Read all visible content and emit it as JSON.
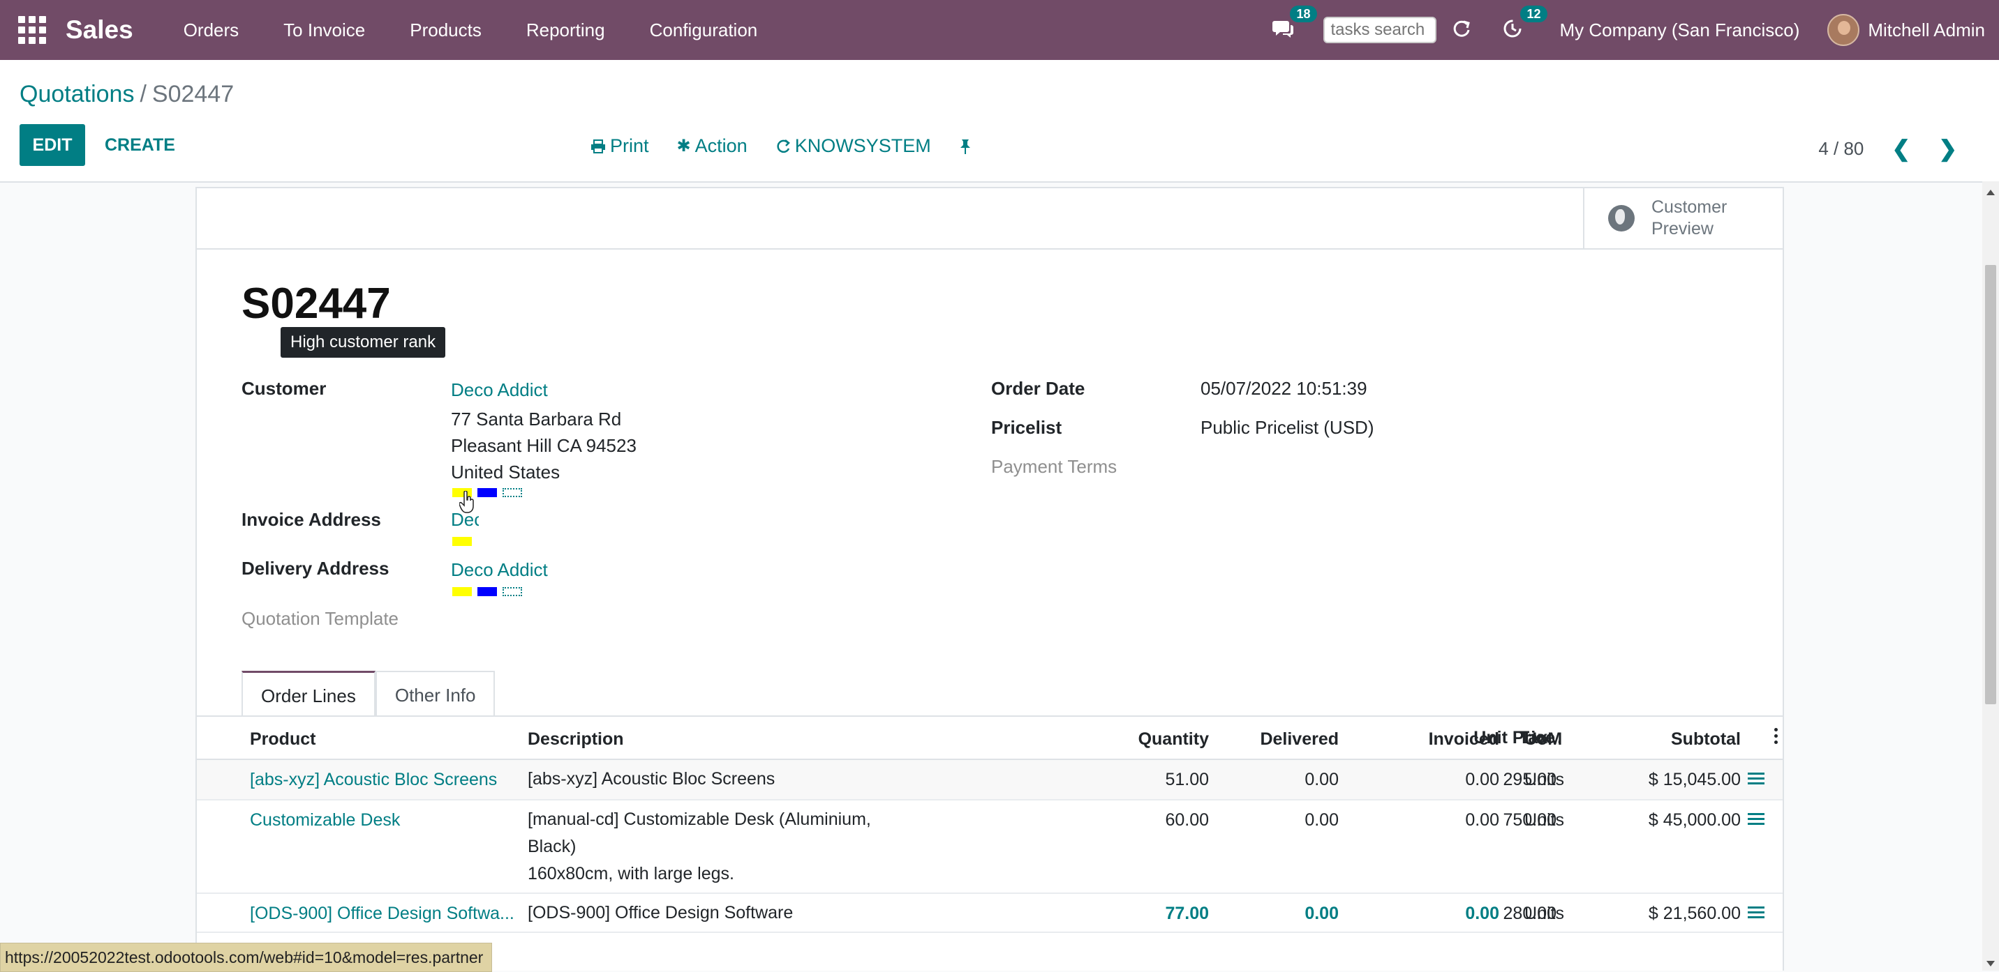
{
  "navbar": {
    "brand": "Sales",
    "menu": [
      "Orders",
      "To Invoice",
      "Products",
      "Reporting",
      "Configuration"
    ],
    "messages_count": "18",
    "tasks_search_placeholder": "tasks search",
    "activities_count": "12",
    "company": "My Company (San Francisco)",
    "user": "Mitchell Admin"
  },
  "breadcrumb": {
    "parent": "Quotations",
    "separator": "/",
    "current": "S02447"
  },
  "buttons": {
    "edit": "EDIT",
    "create": "CREATE"
  },
  "actions": {
    "print": "Print",
    "action": "Action",
    "knowsystem": "KNOWSYSTEM"
  },
  "pager": {
    "value": "4 / 80"
  },
  "sheet": {
    "customer_preview": "Customer Preview",
    "title": "S02447",
    "customer_label": "Customer",
    "customer_name": "Deco Addict",
    "address": [
      "77 Santa Barbara Rd",
      "Pleasant Hill CA 94523",
      "United States"
    ],
    "invoice_address_label": "Invoice Address",
    "invoice_address_value": "Deco Addict",
    "delivery_address_label": "Delivery Address",
    "delivery_address_value": "Deco Addict",
    "quotation_template_label": "Quotation Template",
    "order_date_label": "Order Date",
    "order_date_value": "05/07/2022 10:51:39",
    "pricelist_label": "Pricelist",
    "pricelist_value": "Public Pricelist (USD)",
    "payment_terms_label": "Payment Terms",
    "tooltip": "High customer rank"
  },
  "tags": {
    "colors": [
      "#ffff00",
      "#0000ff",
      "empty"
    ]
  },
  "tabs": [
    "Order Lines",
    "Other Info"
  ],
  "table": {
    "headers": [
      "Product",
      "Description",
      "Quantity",
      "Delivered",
      "Invoiced",
      "UoM",
      "Unit Price",
      "Tax...",
      "Subtotal"
    ],
    "rows": [
      {
        "product": "[abs-xyz] Acoustic Bloc Screens",
        "description": [
          "[abs-xyz] Acoustic Bloc Screens"
        ],
        "quantity": "51.00",
        "delivered": "0.00",
        "invoiced": "0.00",
        "uom": "Units",
        "unit_price": "295.00",
        "tax": "",
        "subtotal": "$ 15,045.00"
      },
      {
        "product": "Customizable Desk",
        "description": [
          "[manual-cd] Customizable Desk (Aluminium,",
          "Black)",
          "160x80cm, with large legs."
        ],
        "quantity": "60.00",
        "delivered": "0.00",
        "invoiced": "0.00",
        "uom": "Units",
        "unit_price": "750.00",
        "tax": "",
        "subtotal": "$ 45,000.00"
      },
      {
        "product": "[ODS-900] Office Design Softwa...",
        "description": [
          "[ODS-900] Office Design Software"
        ],
        "quantity": "77.00",
        "delivered": "0.00",
        "invoiced": "0.00",
        "uom": "Units",
        "unit_price": "280.00",
        "tax": "",
        "subtotal": "$ 21,560.00"
      }
    ]
  },
  "status_link": "https://20052022test.odootools.com/web#id=10&model=res.partner"
}
